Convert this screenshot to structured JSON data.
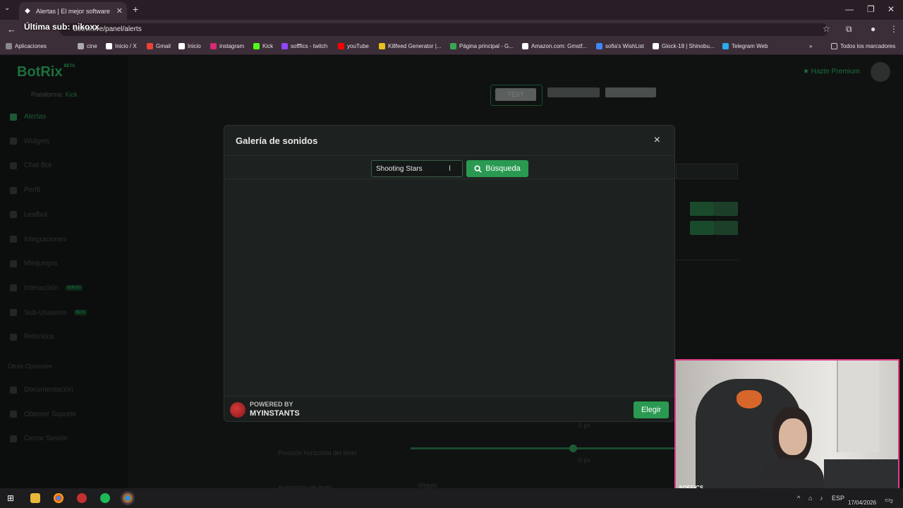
{
  "browser": {
    "tab_title": "Alertas | El mejor software para",
    "url": "botrix.live/panel/alerts",
    "overlay_text": "Última sub: nikoxx",
    "bookmarks": [
      {
        "label": "Aplicaciones",
        "icon": "apps-icon"
      },
      {
        "label": "cine",
        "icon": "folder-icon"
      },
      {
        "label": "Inicio / X",
        "icon": "x-icon"
      },
      {
        "label": "Gmail",
        "icon": "gmail-icon"
      },
      {
        "label": "Inicio",
        "icon": "x-icon"
      },
      {
        "label": "instagram",
        "icon": "instagram-icon"
      },
      {
        "label": "Kick",
        "icon": "kick-icon"
      },
      {
        "label": "sofffics - twitch",
        "icon": "twitch-icon"
      },
      {
        "label": "youTube",
        "icon": "youtube-icon"
      },
      {
        "label": "Killfeed Generator |...",
        "icon": "killfeed-icon"
      },
      {
        "label": "Página principal - G...",
        "icon": "drive-icon"
      },
      {
        "label": "Amazon.com: Gmstf...",
        "icon": "amazon-icon"
      },
      {
        "label": "sofia's WishList",
        "icon": "wishlist-icon"
      },
      {
        "label": "Glock-18 | Shinobu...",
        "icon": "steam-icon"
      },
      {
        "label": "Telegram Web",
        "icon": "telegram-icon"
      }
    ],
    "bookmarks_folder": "Todos los marcadores"
  },
  "app": {
    "logo": "BotRix",
    "logo_badge": "BETA",
    "platform_label": "Plataforma:",
    "platform_value": "Kick",
    "premium": "Hazte Premium",
    "sidebar": [
      {
        "label": "Alertas",
        "active": true
      },
      {
        "label": "Widgets"
      },
      {
        "label": "Chat Bot"
      },
      {
        "label": "Perfil"
      },
      {
        "label": "Leafbot"
      },
      {
        "label": "Integraciones"
      },
      {
        "label": "Minijuegos"
      },
      {
        "label": "Interacción",
        "badge": "NUEVO"
      },
      {
        "label": "Sub-Usuarios",
        "badge": "BETA"
      },
      {
        "label": "Referidos"
      }
    ],
    "sidebar_heading": "Otras Opciones",
    "sidebar_other": [
      {
        "label": "Documentación"
      },
      {
        "label": "Obtener Soporte"
      },
      {
        "label": "Cerrar Sesión"
      }
    ],
    "bg_text_button": "TEXT",
    "bg_label_horizontal": "Posición horizontal del texto",
    "bg_label_animation": "Animación de texto",
    "bg_value_px1": "0 px",
    "bg_value_px2": "0 px",
    "bg_select_value": "Wiggle"
  },
  "modal": {
    "title": "Galería de sonidos",
    "search_value": "Shooting Stars",
    "search_button": "Búsqueda",
    "powered_by": "POWERED BY",
    "brand": "MYINSTANTS",
    "choose_button": "Elegir"
  },
  "webcam": {
    "tag": "SOFFICS"
  },
  "taskbar": {
    "lang": "ESP",
    "date": "17/04/2026",
    "notifications": "2"
  }
}
